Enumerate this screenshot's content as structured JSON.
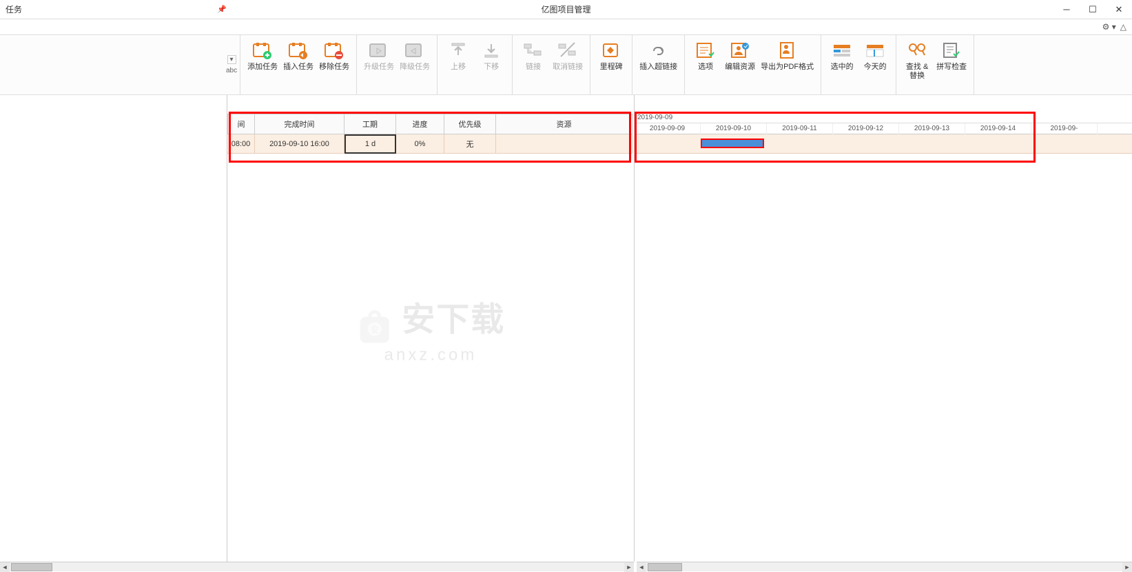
{
  "titlebar": {
    "panel_title": "任务",
    "app_title": "亿图项目管理"
  },
  "ribbon": {
    "mini_abc": "abc",
    "add_task": "添加任务",
    "insert_task": "插入任务",
    "remove_task": "移除任务",
    "upgrade_task": "升级任务",
    "downgrade_task": "降级任务",
    "move_up": "上移",
    "move_down": "下移",
    "link": "链接",
    "unlink": "取消链接",
    "milestone": "里程碑",
    "insert_hyperlink": "插入超链接",
    "options": "选项",
    "edit_resource": "编辑资源",
    "export_pdf": "导出为PDF格式",
    "selected": "选中的",
    "today": "今天的",
    "find_replace": "查找 &\n替换",
    "spell_check": "拼写检查"
  },
  "grid": {
    "headers": {
      "time_partial": "间",
      "finish_time": "完成时间",
      "duration": "工期",
      "progress": "进度",
      "priority": "优先级",
      "resource": "资源"
    },
    "row": {
      "start_partial": "08:00",
      "finish": "2019-09-10 16:00",
      "duration": "1 d",
      "progress": "0%",
      "priority": "无",
      "resource": ""
    }
  },
  "timeline": {
    "start_label": "2019-09-09",
    "dates": [
      "2019-09-09",
      "2019-09-10",
      "2019-09-11",
      "2019-09-12",
      "2019-09-13",
      "2019-09-14",
      "2019-09-"
    ]
  },
  "watermark": {
    "text1": "安下载",
    "text2": "anxz.com"
  }
}
